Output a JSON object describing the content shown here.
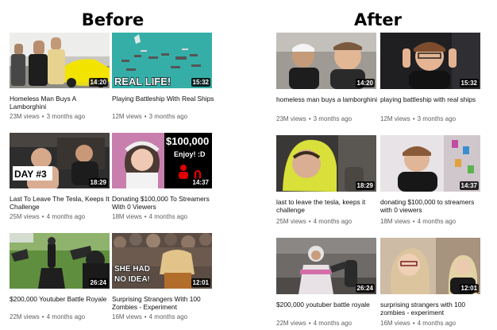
{
  "headings": {
    "before": "Before",
    "after": "After"
  },
  "before": {
    "videos": [
      {
        "title": "Homeless Man Buys A Lamborghini",
        "duration": "14:20",
        "views": "23M views",
        "age": "3 months ago",
        "thumb_text": ""
      },
      {
        "title": "Playing Battleship With Real Ships",
        "duration": "15:32",
        "views": "12M views",
        "age": "3 months ago",
        "thumb_text": "REAL LIFE!"
      },
      {
        "title": "Last To Leave The Tesla, Keeps It Challenge",
        "duration": "18:29",
        "views": "25M views",
        "age": "4 months ago",
        "thumb_text": "DAY #3"
      },
      {
        "title": "Donating $100,000 To Streamers With 0 Viewers",
        "duration": "14:37",
        "views": "18M views",
        "age": "4 months ago",
        "thumb_text": "$100,000",
        "thumb_text_2": "Enjoy! :D",
        "thumb_text_3": "0"
      },
      {
        "title": "$200,000 Youtuber Battle Royale",
        "duration": "26:24",
        "views": "22M views",
        "age": "4 months ago",
        "thumb_text": ""
      },
      {
        "title": "Surprising Strangers With 100 Zombies - Experiment",
        "duration": "12:01",
        "views": "16M views",
        "age": "4 months ago",
        "thumb_text": "SHE HAD",
        "thumb_text_2": "NO IDEA!"
      }
    ]
  },
  "after": {
    "videos": [
      {
        "title": "homeless man buys a lamborghini",
        "duration": "14:20",
        "views": "23M views",
        "age": "3 months ago"
      },
      {
        "title": "playing battleship with real ships",
        "duration": "15:32",
        "views": "12M views",
        "age": "3 months ago"
      },
      {
        "title": "last to leave the tesla, keeps it challenge",
        "duration": "18:29",
        "views": "25M views",
        "age": "4 months ago"
      },
      {
        "title": "donating $100,000 to streamers with 0 viewers",
        "duration": "14:37",
        "views": "18M views",
        "age": "4 months ago"
      },
      {
        "title": "$200,000 youtuber battle royale",
        "duration": "26:24",
        "views": "22M views",
        "age": "4 months ago"
      },
      {
        "title": "surprising strangers with 100 zombies - experiment",
        "duration": "12:01",
        "views": "16M views",
        "age": "4 months ago"
      }
    ]
  },
  "icons": {
    "thumbnail": "video-thumbnail",
    "duration_badge": "clock-badge"
  },
  "colors": {
    "title_text": "#0f0f0f",
    "meta_text": "#606060",
    "duration_bg": "#000000",
    "thumb_yellow_text": "#f2e600",
    "thumb_red": "#e10000"
  }
}
